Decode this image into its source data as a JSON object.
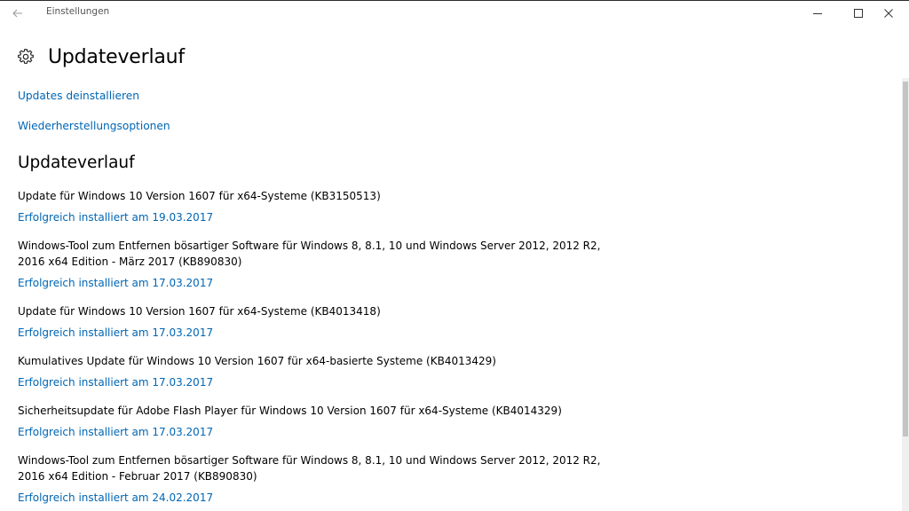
{
  "window": {
    "app_title": "Einstellungen"
  },
  "page": {
    "title": "Updateverlauf"
  },
  "links": {
    "uninstall": "Updates deinstallieren",
    "recovery": "Wiederherstellungsoptionen"
  },
  "section": {
    "title": "Updateverlauf"
  },
  "updates": [
    {
      "name": "Update für Windows 10 Version 1607 für x64-Systeme (KB3150513)",
      "status": "Erfolgreich installiert am 19.03.2017"
    },
    {
      "name": "Windows-Tool zum Entfernen bösartiger Software für Windows 8, 8.1, 10 und Windows Server 2012, 2012 R2, 2016 x64 Edition - März 2017 (KB890830)",
      "status": "Erfolgreich installiert am 17.03.2017"
    },
    {
      "name": "Update für Windows 10 Version 1607 für x64-Systeme (KB4013418)",
      "status": "Erfolgreich installiert am 17.03.2017"
    },
    {
      "name": "Kumulatives Update für Windows 10 Version 1607 für x64-basierte Systeme (KB4013429)",
      "status": "Erfolgreich installiert am 17.03.2017"
    },
    {
      "name": "Sicherheitsupdate für Adobe Flash Player für Windows 10 Version 1607 für x64-Systeme (KB4014329)",
      "status": "Erfolgreich installiert am 17.03.2017"
    },
    {
      "name": "Windows-Tool zum Entfernen bösartiger Software für Windows 8, 8.1, 10 und Windows Server 2012, 2012 R2, 2016 x64 Edition - Februar 2017 (KB890830)",
      "status": "Erfolgreich installiert am 24.02.2017"
    }
  ],
  "colors": {
    "link": "#0066b4",
    "text": "#000000",
    "background": "#ffffff"
  },
  "icons": {
    "back": "back-arrow-icon",
    "settings": "gear-icon",
    "minimize": "minimize-icon",
    "maximize": "maximize-icon",
    "close": "close-icon"
  }
}
